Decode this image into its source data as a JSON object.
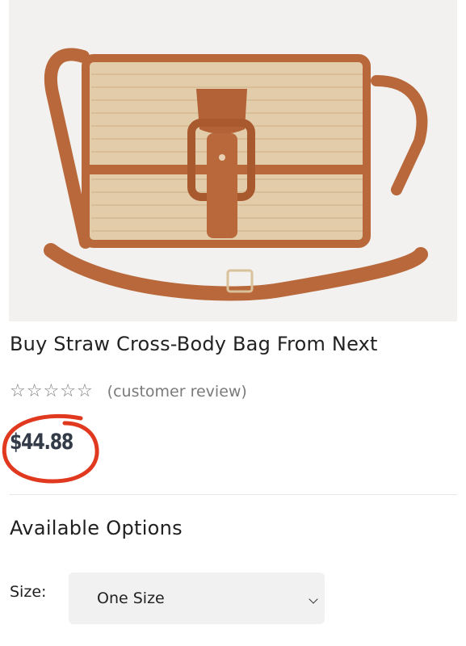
{
  "product": {
    "title": "Buy Straw Cross-Body Bag From Next",
    "image_alt": "Straw cross-body bag with tan leather trim",
    "rating": {
      "stars_filled": 0,
      "stars_total": 5,
      "star_glyph": "☆",
      "review_text": "(customer review)"
    },
    "price": "$44.88",
    "price_highlight_color": "#e0391f"
  },
  "options": {
    "heading": "Available Options",
    "size": {
      "label": "Size:",
      "selected": "One Size"
    }
  },
  "colors": {
    "leather": "#b8683a",
    "straw": "#e2ccaa"
  }
}
